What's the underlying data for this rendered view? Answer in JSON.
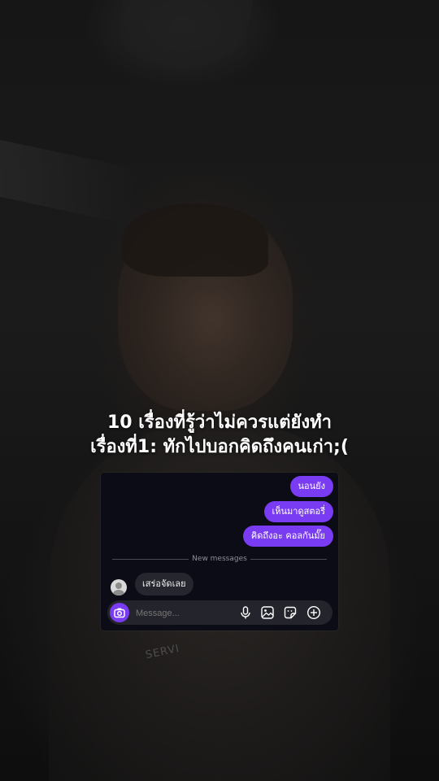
{
  "caption": {
    "line1": "10 เรื่องที่รู้ว่าไม่ควรแต่ยังทำ",
    "line2": "เรื่องที่1: ทักไปบอกคิดถึงคนเก่า;("
  },
  "chat": {
    "outgoing": [
      {
        "text": "นอนยัง"
      },
      {
        "text": "เห็นมาดูสตอรี่"
      },
      {
        "text": "คิดถึงอะ คอลกันมั๊ย"
      }
    ],
    "divider_label": "New messages",
    "incoming": [
      {
        "text": "เสร่อจัดเลย"
      }
    ],
    "composer": {
      "placeholder": "Message..."
    }
  },
  "background_text": {
    "shirt": "SERVI"
  },
  "colors": {
    "accent": "#7a3cf2",
    "chat_bg": "#0c0c16",
    "incoming_bubble": "#26262f",
    "composer_bg": "#24242c"
  },
  "icons": [
    "camera-icon",
    "microphone-icon",
    "gallery-icon",
    "sticker-icon",
    "plus-circle-icon",
    "avatar-icon"
  ]
}
